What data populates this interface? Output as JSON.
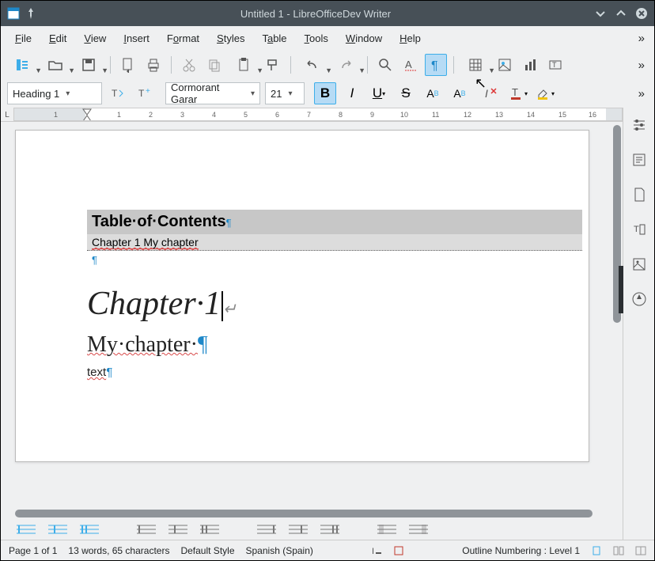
{
  "window": {
    "title": "Untitled 1 - LibreOfficeDev Writer"
  },
  "menus": {
    "file": "File",
    "edit": "Edit",
    "view": "View",
    "insert": "Insert",
    "format": "Format",
    "styles": "Styles",
    "table": "Table",
    "tools": "Tools",
    "window": "Window",
    "help": "Help"
  },
  "format_bar": {
    "paragraph_style": "Heading 1",
    "font_name": "Cormorant Garar",
    "font_size": "21"
  },
  "ruler": {
    "numbers": [
      "1",
      "1",
      "2",
      "3",
      "4",
      "5",
      "6",
      "7",
      "8",
      "9",
      "10",
      "11",
      "12",
      "13",
      "14",
      "15",
      "16"
    ]
  },
  "document": {
    "toc_title": "Table·of·Contents",
    "toc_entry": "Chapter 1  My chapter",
    "heading1": "Chapter·1",
    "heading2": "My·chapter·",
    "body_text": "text"
  },
  "statusbar": {
    "page": "Page 1 of 1",
    "words": "13 words, 65 characters",
    "style": "Default Style",
    "language": "Spanish (Spain)",
    "outline": "Outline Numbering : Level 1"
  }
}
